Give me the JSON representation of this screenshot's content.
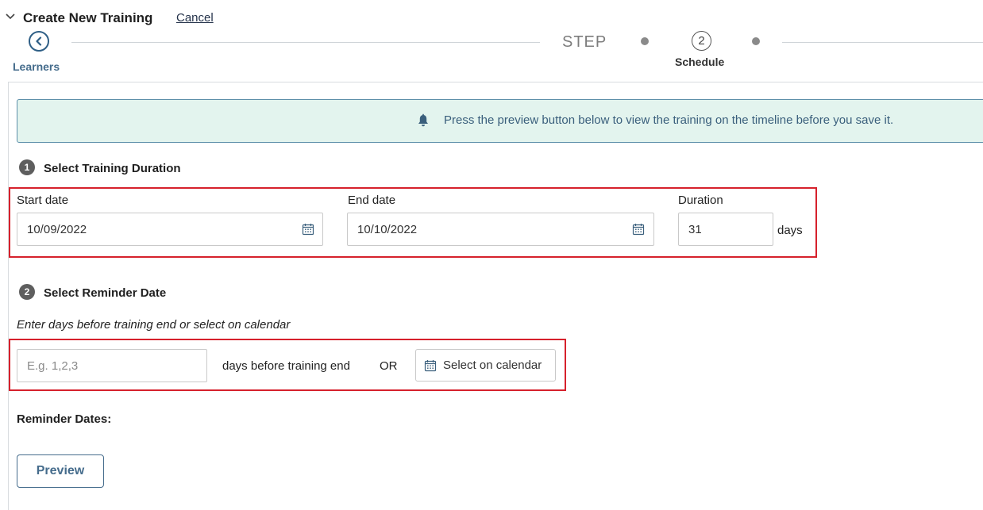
{
  "header": {
    "title": "Create New Training",
    "cancel_label": "Cancel"
  },
  "stepper": {
    "previous_step_label": "Learners",
    "step_word": "STEP",
    "current_step_number": "2",
    "current_step_label": "Schedule"
  },
  "banner": {
    "icon": "bell-icon",
    "text": "Press the preview button below to view the training on the timeline before you save it."
  },
  "duration_section": {
    "number": "1",
    "title": "Select Training Duration",
    "start_date": {
      "label": "Start date",
      "value": "10/09/2022",
      "icon": "calendar-icon"
    },
    "end_date": {
      "label": "End date",
      "value": "10/10/2022",
      "icon": "calendar-icon"
    },
    "duration": {
      "label": "Duration",
      "value": "31",
      "unit": "days"
    }
  },
  "reminder_section": {
    "number": "2",
    "title": "Select Reminder Date",
    "hint": "Enter days before training end or select on calendar",
    "days_input_placeholder": "E.g. 1,2,3",
    "days_suffix": "days before training end",
    "or_label": "OR",
    "calendar_button_label": "Select on calendar",
    "reminder_dates_label": "Reminder Dates:"
  },
  "footer": {
    "preview_label": "Preview"
  },
  "colors": {
    "accent": "#456c8c",
    "banner_bg": "#e3f4ee",
    "highlight": "#d6212c"
  }
}
